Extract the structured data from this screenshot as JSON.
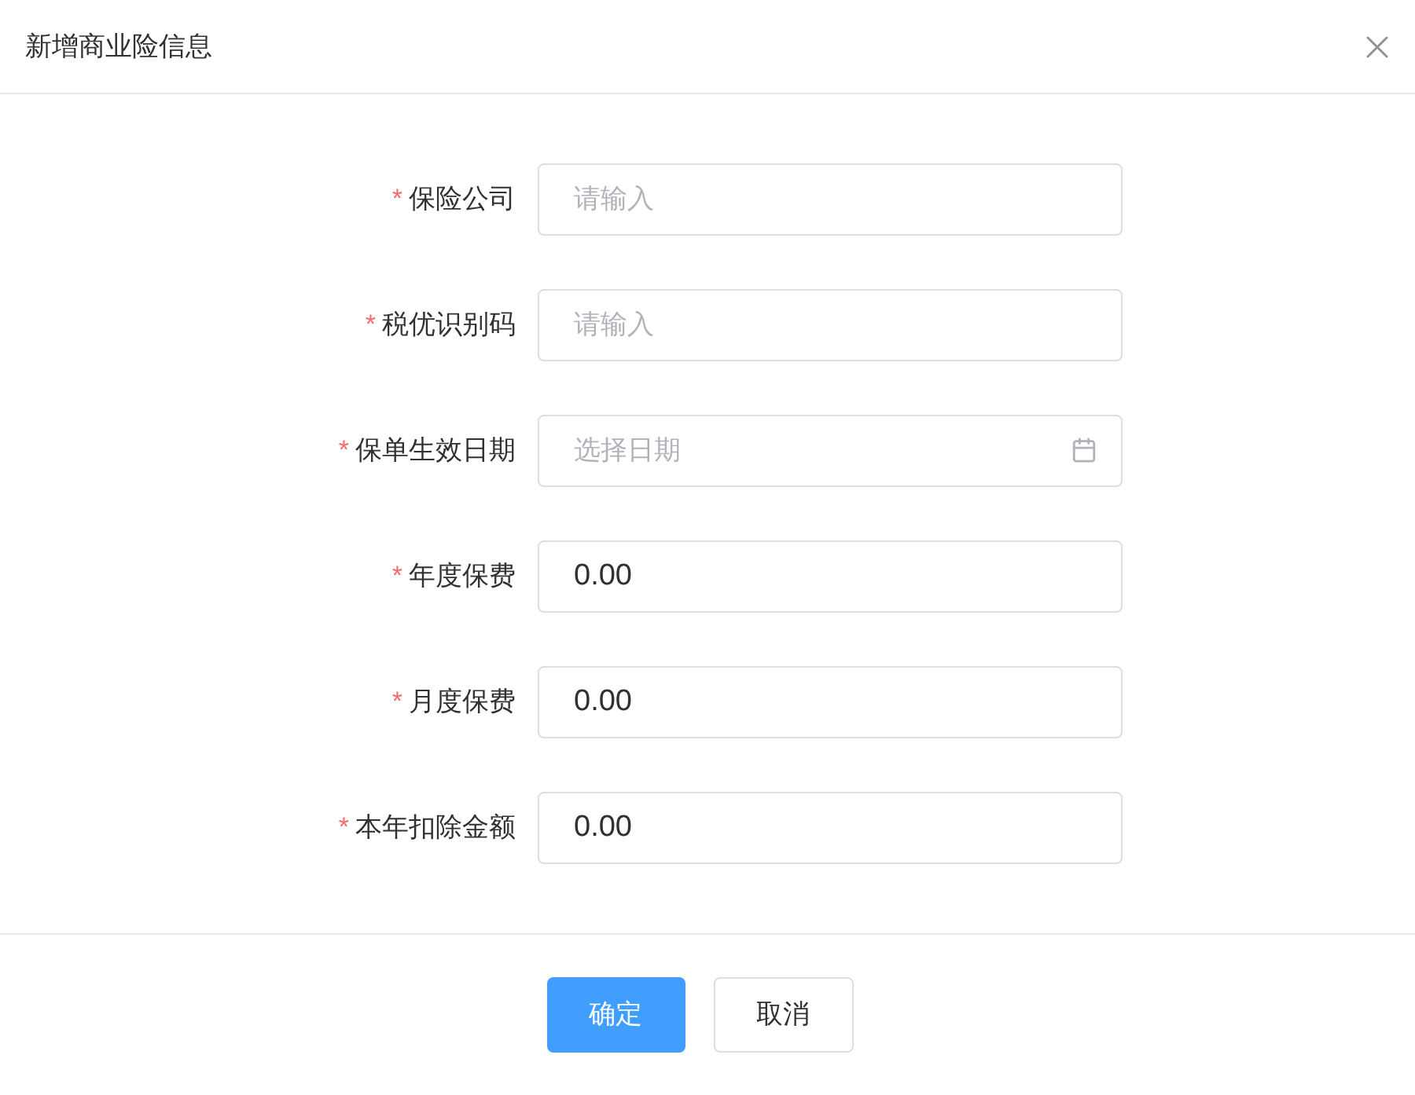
{
  "dialog": {
    "title": "新增商业险信息"
  },
  "fields": [
    {
      "kind": "text",
      "required_mark": "*",
      "label": "保险公司",
      "placeholder": "请输入"
    },
    {
      "kind": "text",
      "required_mark": "*",
      "label": "税优识别码",
      "placeholder": "请输入"
    },
    {
      "kind": "date",
      "required_mark": "*",
      "label": "保单生效日期",
      "placeholder": "选择日期"
    },
    {
      "kind": "text",
      "required_mark": "*",
      "label": "年度保费",
      "value": "0.00"
    },
    {
      "kind": "text",
      "required_mark": "*",
      "label": "月度保费",
      "value": "0.00"
    },
    {
      "kind": "text",
      "required_mark": "*",
      "label": "本年扣除金额",
      "value": "0.00"
    }
  ],
  "buttons": [
    {
      "kind": "primary",
      "label": "确定"
    },
    {
      "kind": "default",
      "label": "取消"
    }
  ]
}
